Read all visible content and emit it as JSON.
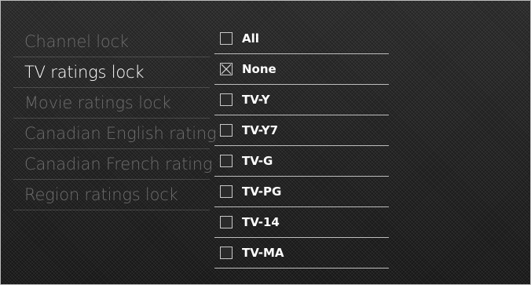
{
  "menu": {
    "items": [
      {
        "label": "Channel lock",
        "state": "disabled"
      },
      {
        "label": "TV ratings lock",
        "state": "active"
      },
      {
        "label": "Movie ratings lock",
        "state": "disabled"
      },
      {
        "label": "Canadian English rating",
        "state": "disabled"
      },
      {
        "label": "Canadian French rating",
        "state": "disabled"
      },
      {
        "label": "Region ratings lock",
        "state": "disabled"
      }
    ]
  },
  "options": {
    "items": [
      {
        "label": "All",
        "checked": false
      },
      {
        "label": "None",
        "checked": true
      },
      {
        "label": "TV-Y",
        "checked": false
      },
      {
        "label": "TV-Y7",
        "checked": false
      },
      {
        "label": "TV-G",
        "checked": false
      },
      {
        "label": "TV-PG",
        "checked": false
      },
      {
        "label": "TV-14",
        "checked": false
      },
      {
        "label": "TV-MA",
        "checked": false
      }
    ]
  },
  "colors": {
    "active_text": "#ffffff",
    "disabled_text": "#6d6d6d",
    "divider": "#bdbdbd",
    "checkbox_border": "#c8c8c8"
  },
  "icons": {
    "checked": "x-mark-icon",
    "unchecked": "empty-checkbox-icon"
  }
}
